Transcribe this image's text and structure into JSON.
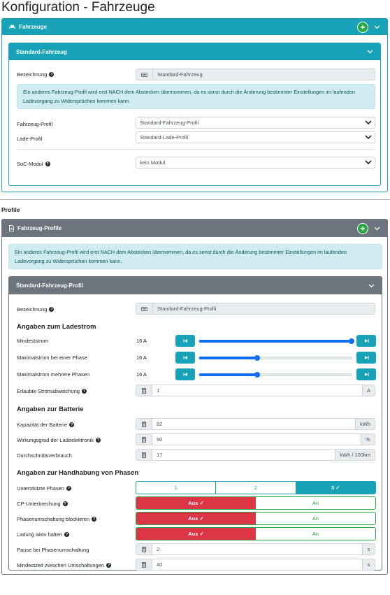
{
  "page_title": "Konfiguration - Fahrzeuge",
  "vehicles_card": {
    "title": "Fahrzeuge",
    "vehicle": {
      "title": "Standard-Fahrzeug",
      "bezeichnung_label": "Bezeichnung",
      "bezeichnung_value": "Standard-Fahrzeug",
      "info": "Ein anderes Fahrzeug-Profil wird erst NACH dem Abstecken übernommen, da es sonst durch die Änderung bestimmter Einstellungen im laufenden Ladevorgang zu Widersprüchen kommen kann.",
      "fahrzeug_profil_label": "Fahrzeug-Profil",
      "fahrzeug_profil_value": "Standard-Fahrzeug-Profil",
      "lade_profil_label": "Lade-Profil",
      "lade_profil_value": "Standard-Lade-Profil",
      "soc_label": "SoC-Modul",
      "soc_value": "kein Modul"
    }
  },
  "profiles_heading": "Profile",
  "profiles_card": {
    "title": "Fahrzeug-Profile",
    "info": "Ein anderes Fahrzeug-Profil wird erst NACH dem Abstecken übernommen, da es sonst durch die Änderung bestimmter Einstellungen im laufenden Ladevorgang zu Widersprüchen kommen kann.",
    "profile": {
      "title": "Standard-Fahrzeug-Profil",
      "bezeichnung_label": "Bezeichnung",
      "bezeichnung_value": "Standard-Fahrzeug-Profil",
      "ladestrom_heading": "Angaben zum Ladestrom",
      "min_label": "Mindeststrom",
      "min_value": "16 A",
      "min_level": 1.0,
      "max1_label": "Maximalstrom bei einer Phase",
      "max1_value": "16 A",
      "max1_level": 0.38,
      "maxn_label": "Maximalstrom mehrere Phasen",
      "maxn_value": "16 A",
      "maxn_level": 0.38,
      "abweichung_label": "Erlaubte Stromabweichung",
      "abweichung_value": "1",
      "abweichung_unit": "A",
      "batterie_heading": "Angaben zur Batterie",
      "kapazitaet_label": "Kapazität der Batterie",
      "kapazitaet_value": "82",
      "kapazitaet_unit": "kWh",
      "wirkungsgrad_label": "Wirkungsgrad der Ladeelektronik",
      "wirkungsgrad_value": "90",
      "wirkungsgrad_unit": "%",
      "verbrauch_label": "Durchschnittsverbrauch",
      "verbrauch_value": "17",
      "verbrauch_unit": "kWh / 100km",
      "handhabung_heading": "Angaben zur Handhabung von Phasen",
      "phasen_label": "Unterstützte Phasen",
      "phasen_options": [
        "1",
        "2",
        "3 ✓"
      ],
      "cp_label": "CP-Unterbrechung",
      "phasen_block_label": "Phasenumschaltung blockieren",
      "ladung_aktiv_label": "Ladung aktiv halten",
      "aus_label": "Aus ✓",
      "an_label": "An",
      "pause_label": "Pause bei Phasenumschaltung",
      "pause_value": "2",
      "pause_unit": "s",
      "mindestzeit_label": "Mindestzeit zwischen Umschaltungen",
      "mindestzeit_value": "40",
      "mindestzeit_unit": "s"
    }
  }
}
